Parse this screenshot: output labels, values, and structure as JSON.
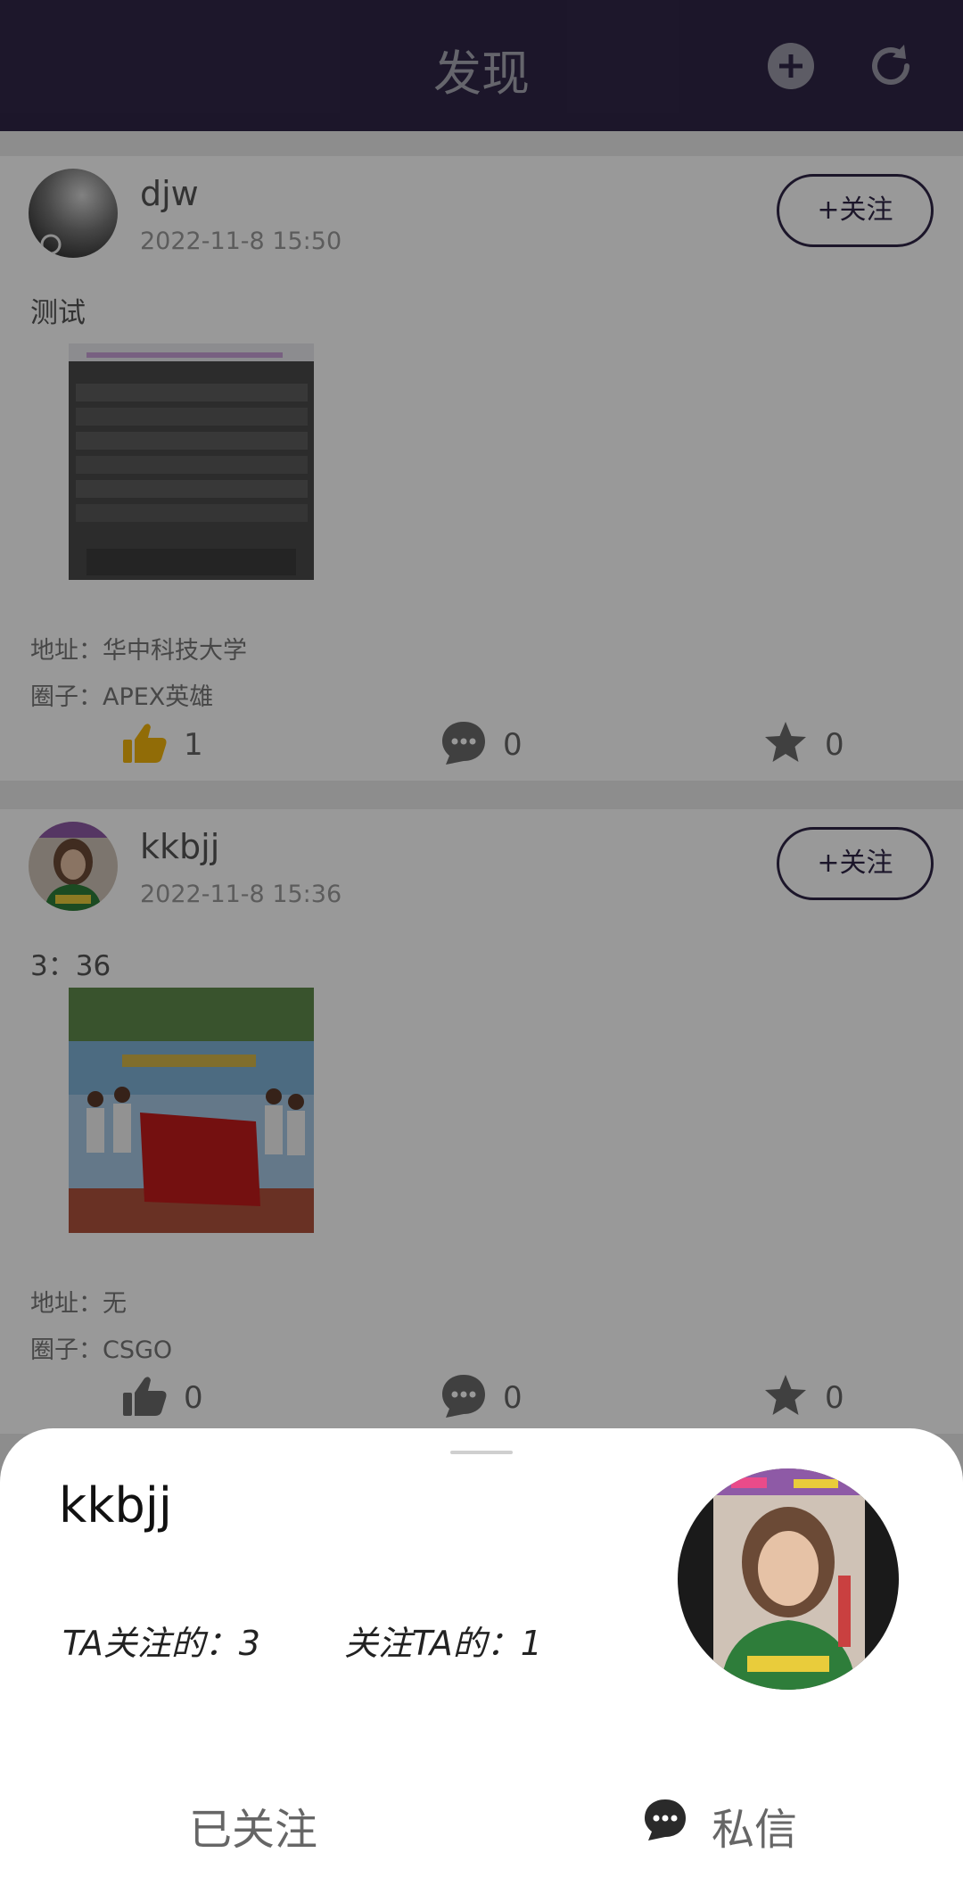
{
  "header": {
    "title": "发现",
    "add_icon": "plus-circle-icon",
    "refresh_icon": "refresh-icon"
  },
  "posts": [
    {
      "username": "djw",
      "time": "2022-11-8 15:50",
      "follow_label": "+关注",
      "text": "测试",
      "image": "keyboard-photo",
      "address": "地址：华中科技大学",
      "circle": "圈子：APEX英雄",
      "likes": "1",
      "comments": "0",
      "stars": "0",
      "liked": true
    },
    {
      "username": "kkbjj",
      "time": "2022-11-8 15:36",
      "follow_label": "+关注",
      "text": "3：36",
      "image": "group-photo-with-banner",
      "address": "地址：无",
      "circle": "圈子：CSGO",
      "likes": "0",
      "comments": "0",
      "stars": "0",
      "liked": false
    }
  ],
  "sheet": {
    "name": "kkbjj",
    "following": "TA关注的：3",
    "followers": "关注TA的：1",
    "followed_label": "已关注",
    "message_label": "私信"
  },
  "colors": {
    "header_bg": "#302647",
    "like_active": "#f2b40c",
    "icon_gray": "#6b6b6b"
  }
}
